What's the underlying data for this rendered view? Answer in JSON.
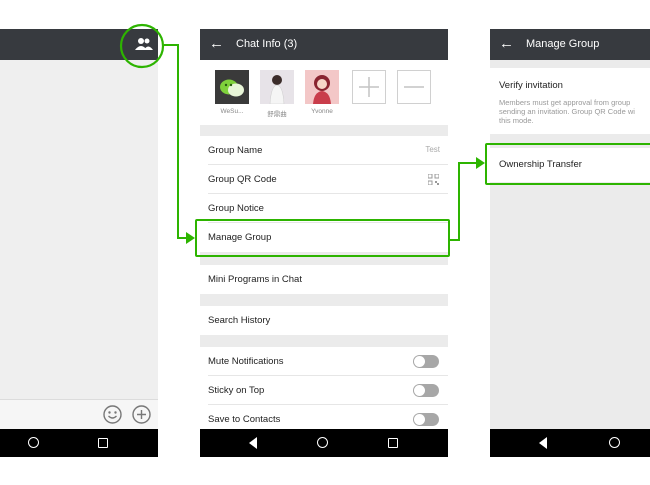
{
  "left_screen": {},
  "chat_info": {
    "title": "Chat Info (3)",
    "members": [
      {
        "name": "WeSu..."
      },
      {
        "name": "舒鼎曲"
      },
      {
        "name": "Yvonne"
      }
    ],
    "rows_group1": [
      {
        "label": "Group Name",
        "value": "Test"
      },
      {
        "label": "Group QR Code"
      },
      {
        "label": "Group Notice"
      },
      {
        "label": "Manage Group"
      }
    ],
    "mini_programs": "Mini Programs in Chat",
    "search_history": "Search History",
    "toggles": [
      {
        "label": "Mute Notifications"
      },
      {
        "label": "Sticky on Top"
      },
      {
        "label": "Save to Contacts"
      }
    ]
  },
  "manage_group": {
    "title": "Manage Group",
    "verify_title": "Verify invitation",
    "verify_desc_lines": [
      "Members must get approval from group",
      "sending an invitation. Group QR Code wi",
      "this mode."
    ],
    "ownership": "Ownership Transfer"
  },
  "colors": {
    "highlight": "#2db400",
    "topbar": "#373a3f"
  }
}
